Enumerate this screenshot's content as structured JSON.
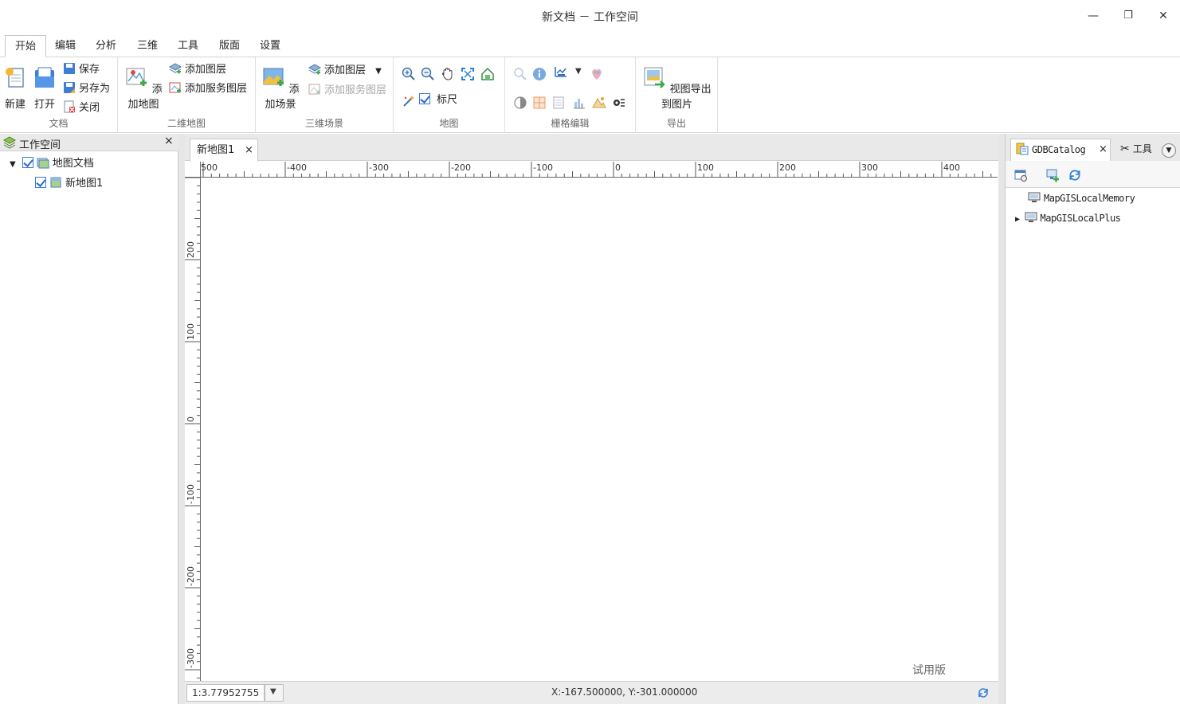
{
  "window": {
    "title": "新文档 － 工作空间",
    "minimize_glyph": "—",
    "restore_glyph": "❐",
    "close_glyph": "✕"
  },
  "menu_tabs": [
    "开始",
    "编辑",
    "分析",
    "三维",
    "工具",
    "版面",
    "设置"
  ],
  "ribbon": {
    "document_group": {
      "label": "文档",
      "new": "新建",
      "open": "打开",
      "save": "保存",
      "save_as": "另存为",
      "close": "关闭"
    },
    "map2d_group": {
      "label": "二维地图",
      "add_map": "添加地图",
      "add_layer": "添加图层",
      "add_service_layer": "添加服务图层"
    },
    "scene3d_group": {
      "label": "三维场景",
      "add_scene": "添加场景",
      "add_layer": "添加图层",
      "add_service_layer": "添加服务图层"
    },
    "map_group": {
      "label": "地图",
      "ruler": "标尺",
      "ruler_checked": true
    },
    "raster_group": {
      "label": "栅格编辑"
    },
    "export_group": {
      "label": "导出",
      "export_image": "视图导出到图片"
    }
  },
  "workspace_panel": {
    "title": "工作空间",
    "close_glyph": "×",
    "tree": [
      {
        "label": "地图文档",
        "checked": true,
        "expanded": true
      },
      {
        "label": "新地图1",
        "checked": true
      }
    ]
  },
  "document": {
    "tab_label": "新地图1",
    "close_glyph": "×",
    "h_ruler_labels": [
      "500",
      "-400",
      "-300",
      "-200",
      "-100",
      "0",
      "100",
      "200",
      "300",
      "400"
    ],
    "v_ruler_labels": [
      "300",
      "200",
      "100",
      "0",
      "-100",
      "-200",
      "-300"
    ],
    "watermark": "试用版",
    "scale": "1:3.77952755",
    "coordinates": "X:-167.500000,  Y:-301.000000"
  },
  "catalog_panel": {
    "tab_catalog": "GDBCatalog",
    "tab_close": "×",
    "tab_tools": "工具",
    "items": [
      {
        "label": "MapGISLocalMemory",
        "expandable": false
      },
      {
        "label": "MapGISLocalPlus",
        "expandable": true
      }
    ]
  }
}
